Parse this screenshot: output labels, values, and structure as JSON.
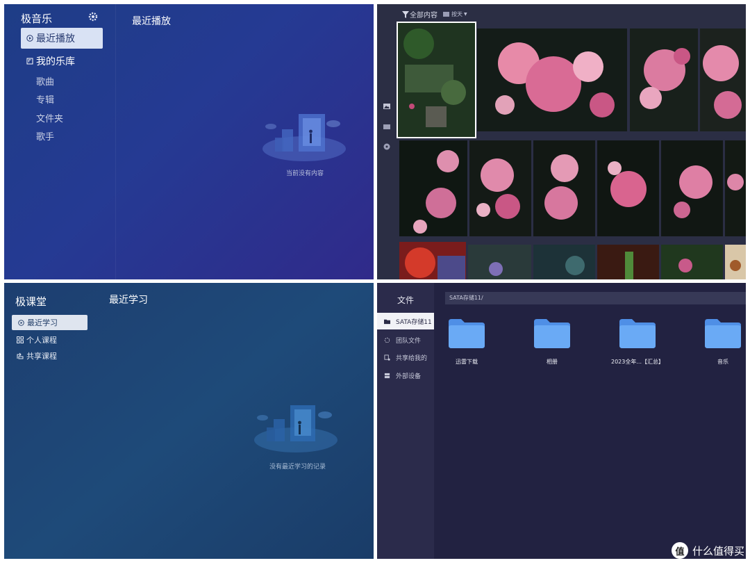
{
  "music": {
    "app_title": "极音乐",
    "nav_active": "最近播放",
    "nav_library": "我的乐库",
    "library_items": [
      "歌曲",
      "专辑",
      "文件夹",
      "歌手"
    ],
    "section_title": "最近播放",
    "empty_text": "当前没有内容"
  },
  "photos": {
    "filter_label": "全部内容",
    "sort_label": "按天",
    "side_icons": [
      "image-icon",
      "folder-icon",
      "compass-icon"
    ]
  },
  "course": {
    "app_title": "极课堂",
    "nav_active": "最近学习",
    "nav_items": [
      "个人课程",
      "共享课程"
    ],
    "section_title": "最近学习",
    "empty_text": "没有最近学习的记录"
  },
  "files": {
    "header": "文件",
    "nav_active": "SATA存储11",
    "nav_items": [
      "团队文件",
      "共享给我的",
      "外部设备"
    ],
    "path": "SATA存储11/",
    "folders": [
      "迅雷下载",
      "相册",
      "2023全年...【汇总】",
      "音乐"
    ]
  },
  "watermark": {
    "logo_char": "值",
    "text": "什么值得买"
  }
}
